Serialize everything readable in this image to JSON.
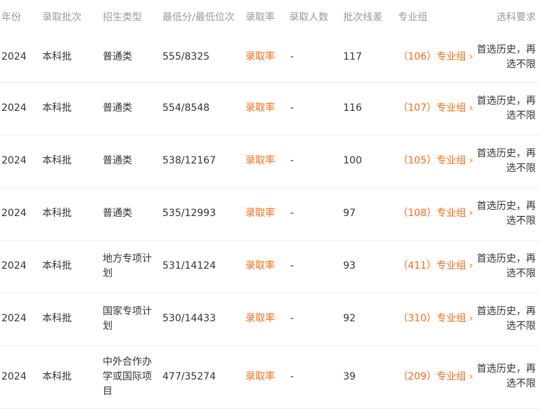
{
  "columns": {
    "year": "年份",
    "batch": "录取批次",
    "type": "招生类型",
    "score": "最低分/最低位次",
    "rate": "录取率",
    "count": "录取人数",
    "diff": "批次线差",
    "group": "专业组",
    "req": "选科要求"
  },
  "rows": [
    {
      "year": "2024",
      "batch": "本科批",
      "type": "普通类",
      "score": "555/8325",
      "rate": "录取率",
      "count": "-",
      "diff": "117",
      "group": "（106）专业组 ›",
      "req": "首选历史，再选不限"
    },
    {
      "year": "2024",
      "batch": "本科批",
      "type": "普通类",
      "score": "554/8548",
      "rate": "录取率",
      "count": "-",
      "diff": "116",
      "group": "（107）专业组 ›",
      "req": "首选历史，再选不限"
    },
    {
      "year": "2024",
      "batch": "本科批",
      "type": "普通类",
      "score": "538/12167",
      "rate": "录取率",
      "count": "-",
      "diff": "100",
      "group": "（105）专业组 ›",
      "req": "首选历史，再选不限"
    },
    {
      "year": "2024",
      "batch": "本科批",
      "type": "普通类",
      "score": "535/12993",
      "rate": "录取率",
      "count": "-",
      "diff": "97",
      "group": "（108）专业组 ›",
      "req": "首选历史，再选不限"
    },
    {
      "year": "2024",
      "batch": "本科批",
      "type": "地方专项计划",
      "score": "531/14124",
      "rate": "录取率",
      "count": "-",
      "diff": "93",
      "group": "（411）专业组 ›",
      "req": "首选历史，再选不限"
    },
    {
      "year": "2024",
      "batch": "本科批",
      "type": "国家专项计划",
      "score": "530/14433",
      "rate": "录取率",
      "count": "-",
      "diff": "92",
      "group": "（310）专业组 ›",
      "req": "首选历史，再选不限"
    },
    {
      "year": "2024",
      "batch": "本科批",
      "type": "中外合作办学或国际项目",
      "score": "477/35274",
      "rate": "录取率",
      "count": "-",
      "diff": "39",
      "group": "（209）专业组 ›",
      "req": "首选历史，再选不限"
    }
  ]
}
